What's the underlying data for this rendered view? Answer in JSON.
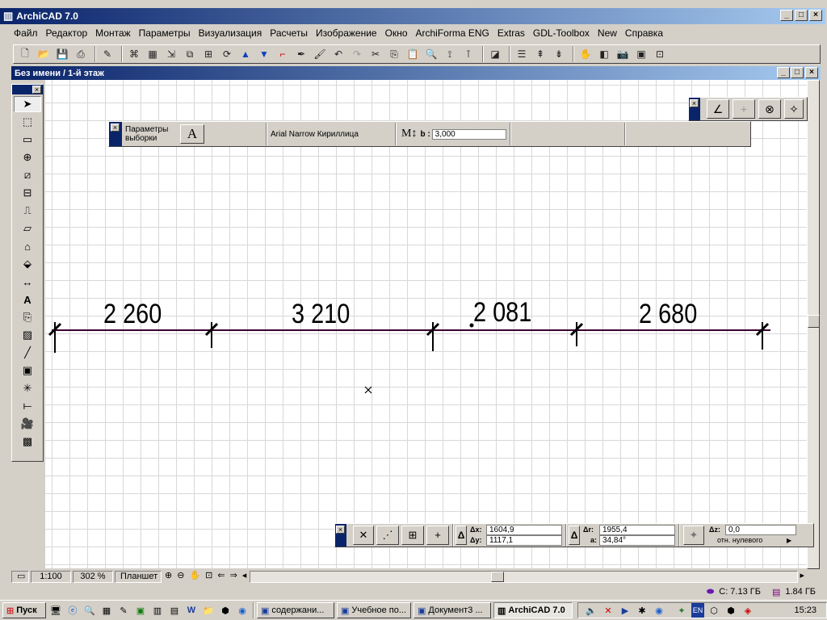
{
  "app": {
    "title": "ArchiCAD 7.0"
  },
  "menu": [
    "Файл",
    "Редактор",
    "Монтаж",
    "Параметры",
    "Визуализация",
    "Расчеты",
    "Изображение",
    "Окно",
    "ArchiForma ENG",
    "Extras",
    "GDL-Toolbox",
    "New",
    "Справка"
  ],
  "document": {
    "title": "Без имени / 1-й этаж"
  },
  "info_box": {
    "section_label_1": "Параметры",
    "section_label_2": "выборки",
    "font_button": "A",
    "font_name": "Arial Narrow Кириллица",
    "marker_label": "M",
    "height_label": "b :",
    "height_value": "3,000"
  },
  "dimensions": [
    "2 260",
    "3 210",
    "2 081",
    "2 680"
  ],
  "coords": {
    "dx_label": "Δx:",
    "dx_value": "1604,9",
    "dy_label": "Δy:",
    "dy_value": "1117,1",
    "dr_label": "Δr:",
    "dr_value": "1955,4",
    "a_label": "a:",
    "a_value": "34,84°",
    "dz_label": "Δz:",
    "dz_value": "0,0",
    "ref_label": "отн. нулевого"
  },
  "status": {
    "scale": "1:100",
    "zoom": "302 %",
    "layer": "Планшет",
    "disk_c": "C: 7.13 ГБ",
    "ram": "1.84 ГБ"
  },
  "taskbar": {
    "start": "Пуск",
    "tasks": [
      "содержани...",
      "Учебное по...",
      "Документ3 ...",
      "ArchiCAD 7.0"
    ],
    "lang": "EN",
    "clock": "15:23"
  },
  "colors": {
    "title_active": "#0a246a",
    "title_gradient_end": "#a6caf0",
    "dim_line": "#3a0030"
  }
}
